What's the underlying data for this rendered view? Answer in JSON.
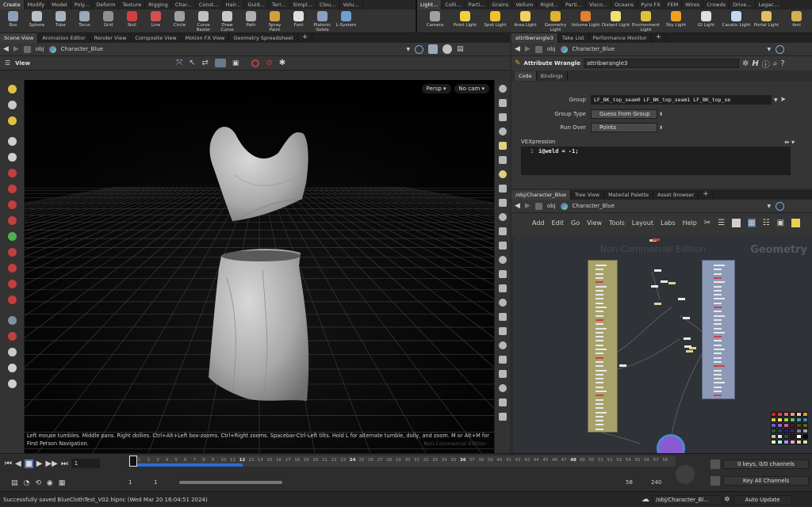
{
  "shelf": {
    "left_tabs": [
      "Create",
      "Modify",
      "Model",
      "Poly...",
      "Deform",
      "Texture",
      "Rigging",
      "Char...",
      "Const...",
      "Hair...",
      "Guid...",
      "Terr...",
      "Simpl...",
      "Clou...",
      "Volu..."
    ],
    "right_tabs": [
      "Light...",
      "Colli...",
      "Parti...",
      "Grains",
      "Vellum",
      "Rigid...",
      "Parti...",
      "Visco...",
      "Oceans",
      "Pyro FX",
      "FEM",
      "Wires",
      "Crowds",
      "Drive...",
      "Legac..."
    ],
    "left_tools": [
      {
        "label": "Box",
        "icon": "box-icon",
        "color": "#8aa0b8"
      },
      {
        "label": "Sphere",
        "icon": "sphere-icon",
        "color": "#b8c0c8"
      },
      {
        "label": "Tube",
        "icon": "tube-icon",
        "color": "#a8b4c0"
      },
      {
        "label": "Torus",
        "icon": "torus-icon",
        "color": "#9aa8b8"
      },
      {
        "label": "Grid",
        "icon": "grid-icon",
        "color": "#909090"
      },
      {
        "label": "Null",
        "icon": "null-icon",
        "color": "#d04040"
      },
      {
        "label": "Line",
        "icon": "line-icon",
        "color": "#d05050"
      },
      {
        "label": "Circle",
        "icon": "circle-icon",
        "color": "#a0a0a0"
      },
      {
        "label": "Curve Bezier",
        "icon": "curve-bezier-icon",
        "color": "#c0c0c0"
      },
      {
        "label": "Draw Curve",
        "icon": "draw-curve-icon",
        "color": "#c8c8c8"
      },
      {
        "label": "Path",
        "icon": "path-icon",
        "color": "#b0b0b0"
      },
      {
        "label": "Spray Paint",
        "icon": "spray-paint-icon",
        "color": "#d0a040"
      },
      {
        "label": "Font",
        "icon": "font-icon",
        "color": "#e0e0e0"
      },
      {
        "label": "Platonic Solids",
        "icon": "platonic-solids-icon",
        "color": "#8aa0c0"
      },
      {
        "label": "L-System",
        "icon": "l-system-icon",
        "color": "#70a0d0"
      }
    ],
    "right_tools": [
      {
        "label": "Camera",
        "icon": "camera-icon",
        "color": "#a0a0a0"
      },
      {
        "label": "Point Light",
        "icon": "point-light-icon",
        "color": "#f0d040"
      },
      {
        "label": "Spot Light",
        "icon": "spot-light-icon",
        "color": "#f0c030"
      },
      {
        "label": "Area Light",
        "icon": "area-light-icon",
        "color": "#f0d060"
      },
      {
        "label": "Geometry Light",
        "icon": "geometry-light-icon",
        "color": "#e0b030"
      },
      {
        "label": "Volume Light",
        "icon": "volume-light-icon",
        "color": "#e08030"
      },
      {
        "label": "Distant Light",
        "icon": "distant-light-icon",
        "color": "#f0e070"
      },
      {
        "label": "Environment Light",
        "icon": "environment-light-icon",
        "color": "#e0c040"
      },
      {
        "label": "Sky Light",
        "icon": "sky-light-icon",
        "color": "#f0a020"
      },
      {
        "label": "GI Light",
        "icon": "gi-light-icon",
        "color": "#e0e0e0"
      },
      {
        "label": "Caustic Light",
        "icon": "caustic-light-icon",
        "color": "#c0d8f0"
      },
      {
        "label": "Portal Light",
        "icon": "portal-light-icon",
        "color": "#e0c060"
      },
      {
        "label": "Ami",
        "icon": "ambient-light-icon",
        "color": "#d0b050"
      }
    ]
  },
  "left_pane": {
    "tabs": [
      "Scene View",
      "Animation Editor",
      "Render View",
      "Composite View",
      "Motion FX View",
      "Geometry Spreadsheet"
    ],
    "path_obj": "obj",
    "path_node": "Character_Blue",
    "view_label": "View",
    "persp_label": "Persp",
    "cam_label": "No cam",
    "help_text": "Left mouse tumbles. Middle pans. Right dollies. Ctrl+Alt+Left box-zooms. Ctrl+Right zooms. Spacebar-Ctrl-Left tilts. Hold L for alternate tumble, dolly, and zoom.    M or Alt+M for First Person Navigation.",
    "watermark": "Non-Commercial Edition"
  },
  "param_pane": {
    "tabs": [
      "attribwrangle3",
      "Take List",
      "Performance Monitor"
    ],
    "path_obj": "obj",
    "path_node": "Character_Blue",
    "node_type": "Attribute Wrangle",
    "node_name": "attribwrangle3",
    "subtabs": [
      "Code",
      "Bindings"
    ],
    "group_label": "Group",
    "group_value": "LF_BK_top_seam0 LF_BK_top_seam1 LF_BK_top_se",
    "group_type_label": "Group Type",
    "group_type_value": "Guess from Group",
    "run_over_label": "Run Over",
    "run_over_value": "Points",
    "vex_label": "VEXpression",
    "code_line_no": "1",
    "code": "i@weld = -1;"
  },
  "network_pane": {
    "tabs": [
      "/obj/Character_Blue",
      "Tree View",
      "Material Palette",
      "Asset Browser"
    ],
    "path_obj": "obj",
    "path_node": "Character_Blue",
    "menu": [
      "Add",
      "Edit",
      "Go",
      "View",
      "Tools",
      "Layout",
      "Labs",
      "Help"
    ],
    "watermark": "Non-Commercial Edition",
    "context_label": "Geometry"
  },
  "palette": [
    "#e02020",
    "#e04040",
    "#f06060",
    "#f09090",
    "#f0c0c0",
    "#e0a020",
    "#e0c040",
    "#f0e060",
    "#a0d040",
    "#60c060",
    "#40a0a0",
    "#4080c0",
    "#6060c0",
    "#a060c0",
    "#c060a0",
    "#402020",
    "#604020",
    "#606020",
    "#206020",
    "#204060",
    "#202060",
    "#402060",
    "#808080",
    "#a0a0a0",
    "#c0c0c0",
    "#e0e0e0",
    "#404040",
    "#202020",
    "#ffffff",
    "#000000",
    "#f0f0a0",
    "#a0f0f0",
    "#a0a0f0",
    "#f0a0f0",
    "#f0d0a0",
    "#d0f0a0"
  ],
  "timeline": {
    "frame": "1",
    "ticks": [
      "1",
      "2",
      "3",
      "4",
      "5",
      "6",
      "7",
      "8",
      "9",
      "10",
      "11",
      "12",
      "13",
      "14",
      "15",
      "16",
      "17",
      "18",
      "19",
      "20",
      "21",
      "22",
      "23",
      "24",
      "25",
      "26",
      "27",
      "28",
      "29",
      "30",
      "31",
      "32",
      "33",
      "34",
      "35",
      "36",
      "37",
      "38",
      "39",
      "40",
      "41",
      "42",
      "43",
      "44",
      "45",
      "46",
      "47",
      "48",
      "49",
      "50",
      "51",
      "52",
      "53",
      "54",
      "55",
      "56",
      "57",
      "58"
    ],
    "range_start": "1",
    "range_start2": "1",
    "range_end": "58",
    "range_end2": "240",
    "keys_label": "0 keys, 0/0 channels",
    "key_all_label": "Key All Channels"
  },
  "status": {
    "message": "Successfully saved BlueClothTest_V02.hipnc (Wed Mar 20 16:04:51 2024)",
    "path": "/obj/Character_Bl...",
    "auto_update": "Auto Update"
  }
}
